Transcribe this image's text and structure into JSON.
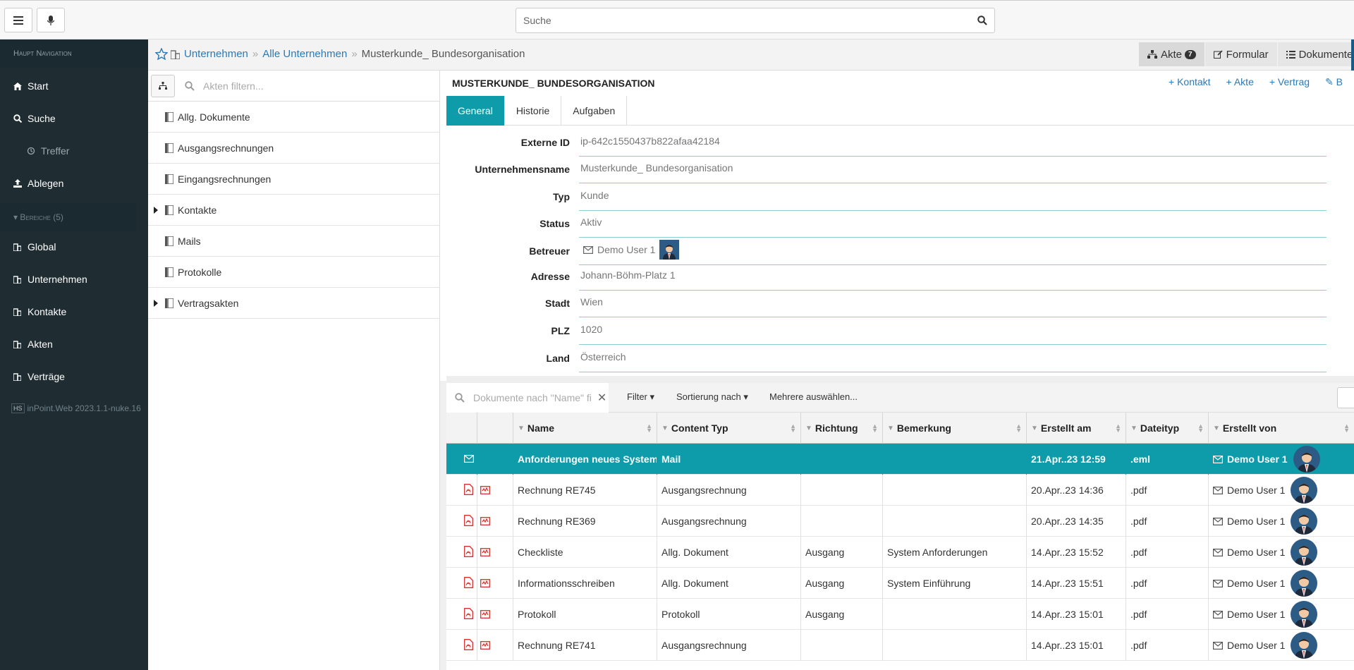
{
  "topbar": {
    "search_placeholder": "Suche"
  },
  "sidebar": {
    "header": "Haupt Navigation",
    "items": [
      {
        "label": "Start",
        "icon": "home-icon"
      },
      {
        "label": "Suche",
        "icon": "search-icon"
      },
      {
        "label": "Treffer",
        "icon": "history-icon"
      },
      {
        "label": "Ablegen",
        "icon": "upload-icon"
      }
    ],
    "section": "Bereiche (5)",
    "areas": [
      "Global",
      "Unternehmen",
      "Kontakte",
      "Akten",
      "Verträge"
    ],
    "version_badge": "HS",
    "version": "inPoint.Web 2023.1.1-nuke.16"
  },
  "breadcrumb": {
    "level1": "Unternehmen",
    "level2": "Alle Unternehmen",
    "current": "Musterkunde_ Bundesorganisation"
  },
  "right_tabs": {
    "akte": "Akte",
    "akte_count": "7",
    "formular": "Formular",
    "dokumente": "Dokumente"
  },
  "tree": {
    "filter_placeholder": "Akten filtern...",
    "folders": [
      {
        "label": "Allg. Dokumente",
        "expandable": false
      },
      {
        "label": "Ausgangsrechnungen",
        "expandable": false
      },
      {
        "label": "Eingangsrechnungen",
        "expandable": false
      },
      {
        "label": "Kontakte",
        "expandable": true
      },
      {
        "label": "Mails",
        "expandable": false
      },
      {
        "label": "Protokolle",
        "expandable": false
      },
      {
        "label": "Vertragsakten",
        "expandable": true
      }
    ]
  },
  "record": {
    "title": "MUSTERKUNDE_ BUNDESORGANISATION",
    "actions": [
      "+ Kontakt",
      "+ Akte",
      "+ Vertrag",
      "✎ B"
    ],
    "tabs": [
      "General",
      "Historie",
      "Aufgaben"
    ],
    "fields": [
      {
        "label": "Externe ID",
        "value": "ip-642c1550437b822afaa42184"
      },
      {
        "label": "Unternehmensname",
        "value": "Musterkunde_ Bundesorganisation"
      },
      {
        "label": "Typ",
        "value": "Kunde"
      },
      {
        "label": "Status",
        "value": "Aktiv"
      },
      {
        "label": "Betreuer",
        "value": "Demo User 1"
      },
      {
        "label": "Adresse",
        "value": "Johann-Böhm-Platz 1"
      },
      {
        "label": "Stadt",
        "value": "Wien"
      },
      {
        "label": "PLZ",
        "value": "1020"
      },
      {
        "label": "Land",
        "value": "Österreich"
      }
    ]
  },
  "docs": {
    "search_placeholder": "Dokumente nach \"Name\" fi",
    "filter": "Filter",
    "sort": "Sortierung nach",
    "multi": "Mehrere auswählen...",
    "columns": [
      "Name",
      "Content Typ",
      "Richtung",
      "Bemerkung",
      "Erstellt am",
      "Dateityp",
      "Erstellt von"
    ],
    "rows": [
      {
        "name": "Anforderungen neues System",
        "type": "Mail",
        "dir": "",
        "note": "",
        "date": "21.Apr..23 12:59",
        "ext": ".eml",
        "by": "Demo User 1",
        "kind": "mail",
        "selected": true
      },
      {
        "name": "Rechnung RE745",
        "type": "Ausgangsrechnung",
        "dir": "",
        "note": "",
        "date": "20.Apr..23 14:36",
        "ext": ".pdf",
        "by": "Demo User 1",
        "kind": "pdf",
        "selected": false
      },
      {
        "name": "Rechnung RE369",
        "type": "Ausgangsrechnung",
        "dir": "",
        "note": "",
        "date": "20.Apr..23 14:35",
        "ext": ".pdf",
        "by": "Demo User 1",
        "kind": "pdf",
        "selected": false
      },
      {
        "name": "Checkliste",
        "type": "Allg. Dokument",
        "dir": "Ausgang",
        "note": "System Anforderungen",
        "date": "14.Apr..23 15:52",
        "ext": ".pdf",
        "by": "Demo User 1",
        "kind": "pdf",
        "selected": false
      },
      {
        "name": "Informationsschreiben",
        "type": "Allg. Dokument",
        "dir": "Ausgang",
        "note": "System Einführung",
        "date": "14.Apr..23 15:51",
        "ext": ".pdf",
        "by": "Demo User 1",
        "kind": "pdf",
        "selected": false
      },
      {
        "name": "Protokoll",
        "type": "Protokoll",
        "dir": "Ausgang",
        "note": "",
        "date": "14.Apr..23 15:01",
        "ext": ".pdf",
        "by": "Demo User 1",
        "kind": "pdf",
        "selected": false
      },
      {
        "name": "Rechnung RE741",
        "type": "Ausgangsrechnung",
        "dir": "",
        "note": "",
        "date": "14.Apr..23 15:01",
        "ext": ".pdf",
        "by": "Demo User 1",
        "kind": "pdf",
        "selected": false
      }
    ]
  },
  "colors": {
    "accent": "#0e9caa",
    "sidebar": "#1f2d33",
    "link": "#2a7ab8",
    "pdf": "#d9302c"
  }
}
